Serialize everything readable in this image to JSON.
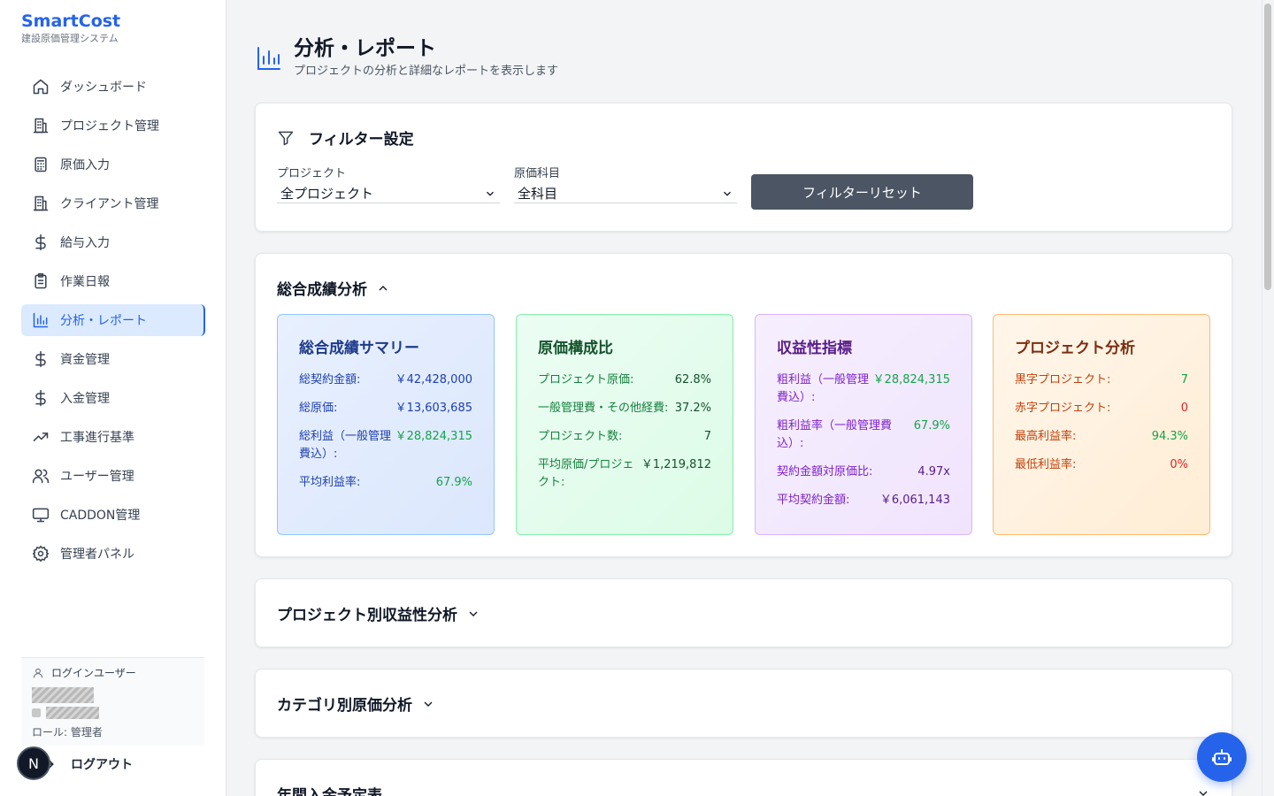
{
  "brand": {
    "name": "SmartCost",
    "subtitle": "建設原価管理システム"
  },
  "sidebar": {
    "items": [
      {
        "label": "ダッシュボード",
        "icon": "home-icon"
      },
      {
        "label": "プロジェクト管理",
        "icon": "building-icon"
      },
      {
        "label": "原価入力",
        "icon": "calculator-icon"
      },
      {
        "label": "クライアント管理",
        "icon": "building-icon"
      },
      {
        "label": "給与入力",
        "icon": "dollar-icon"
      },
      {
        "label": "作業日報",
        "icon": "clipboard-icon"
      },
      {
        "label": "分析・レポート",
        "icon": "bar-chart-icon",
        "active": true
      },
      {
        "label": "資金管理",
        "icon": "dollar-icon"
      },
      {
        "label": "入金管理",
        "icon": "dollar-icon"
      },
      {
        "label": "工事進行基準",
        "icon": "trending-up-icon"
      },
      {
        "label": "ユーザー管理",
        "icon": "users-icon"
      },
      {
        "label": "CADDON管理",
        "icon": "monitor-icon"
      },
      {
        "label": "管理者パネル",
        "icon": "gear-icon"
      }
    ],
    "user_label": "ログインユーザー",
    "role": "ロール: 管理者",
    "logout": "ログアウト",
    "badge": "N"
  },
  "header": {
    "title": "分析・レポート",
    "subtitle": "プロジェクトの分析と詳細なレポートを表示します"
  },
  "filter": {
    "title": "フィルター設定",
    "project_label": "プロジェクト",
    "project_value": "全プロジェクト",
    "cost_label": "原価科目",
    "cost_value": "全科目",
    "reset": "フィルターリセット"
  },
  "overall": {
    "title": "総合成績分析",
    "summary": {
      "title": "総合成績サマリー",
      "rows": [
        {
          "k": "総契約金額:",
          "v": "￥42,428,000"
        },
        {
          "k": "総原価:",
          "v": "￥13,603,685"
        },
        {
          "k": "総利益（一般管理費込）:",
          "v": "￥28,824,315"
        },
        {
          "k": "平均利益率:",
          "v": "67.9%"
        }
      ]
    },
    "cost": {
      "title": "原価構成比",
      "rows": [
        {
          "k": "プロジェクト原価:",
          "v": "62.8%"
        },
        {
          "k": "一般管理費・その他経費:",
          "v": "37.2%"
        },
        {
          "k": "プロジェクト数:",
          "v": "7"
        },
        {
          "k": "平均原価/プロジェクト:",
          "v": "￥1,219,812"
        }
      ]
    },
    "profit": {
      "title": "収益性指標",
      "rows": [
        {
          "k": "粗利益（一般管理費込）:",
          "v": "￥28,824,315"
        },
        {
          "k": "粗利益率（一般管理費込）:",
          "v": "67.9%"
        },
        {
          "k": "契約金額対原価比:",
          "v": "4.97x"
        },
        {
          "k": "平均契約金額:",
          "v": "￥6,061,143"
        }
      ]
    },
    "project": {
      "title": "プロジェクト分析",
      "rows": [
        {
          "k": "黒字プロジェクト:",
          "v": "7"
        },
        {
          "k": "赤字プロジェクト:",
          "v": "0"
        },
        {
          "k": "最高利益率:",
          "v": "94.3%"
        },
        {
          "k": "最低利益率:",
          "v": "0%"
        }
      ]
    }
  },
  "sections": {
    "project_profit": "プロジェクト別収益性分析",
    "category_cost": "カテゴリ別原価分析",
    "yearly": "年間入金予定表"
  },
  "colors": {
    "accent": "#2563eb",
    "positive": "#16a34a",
    "negative": "#dc2626"
  }
}
